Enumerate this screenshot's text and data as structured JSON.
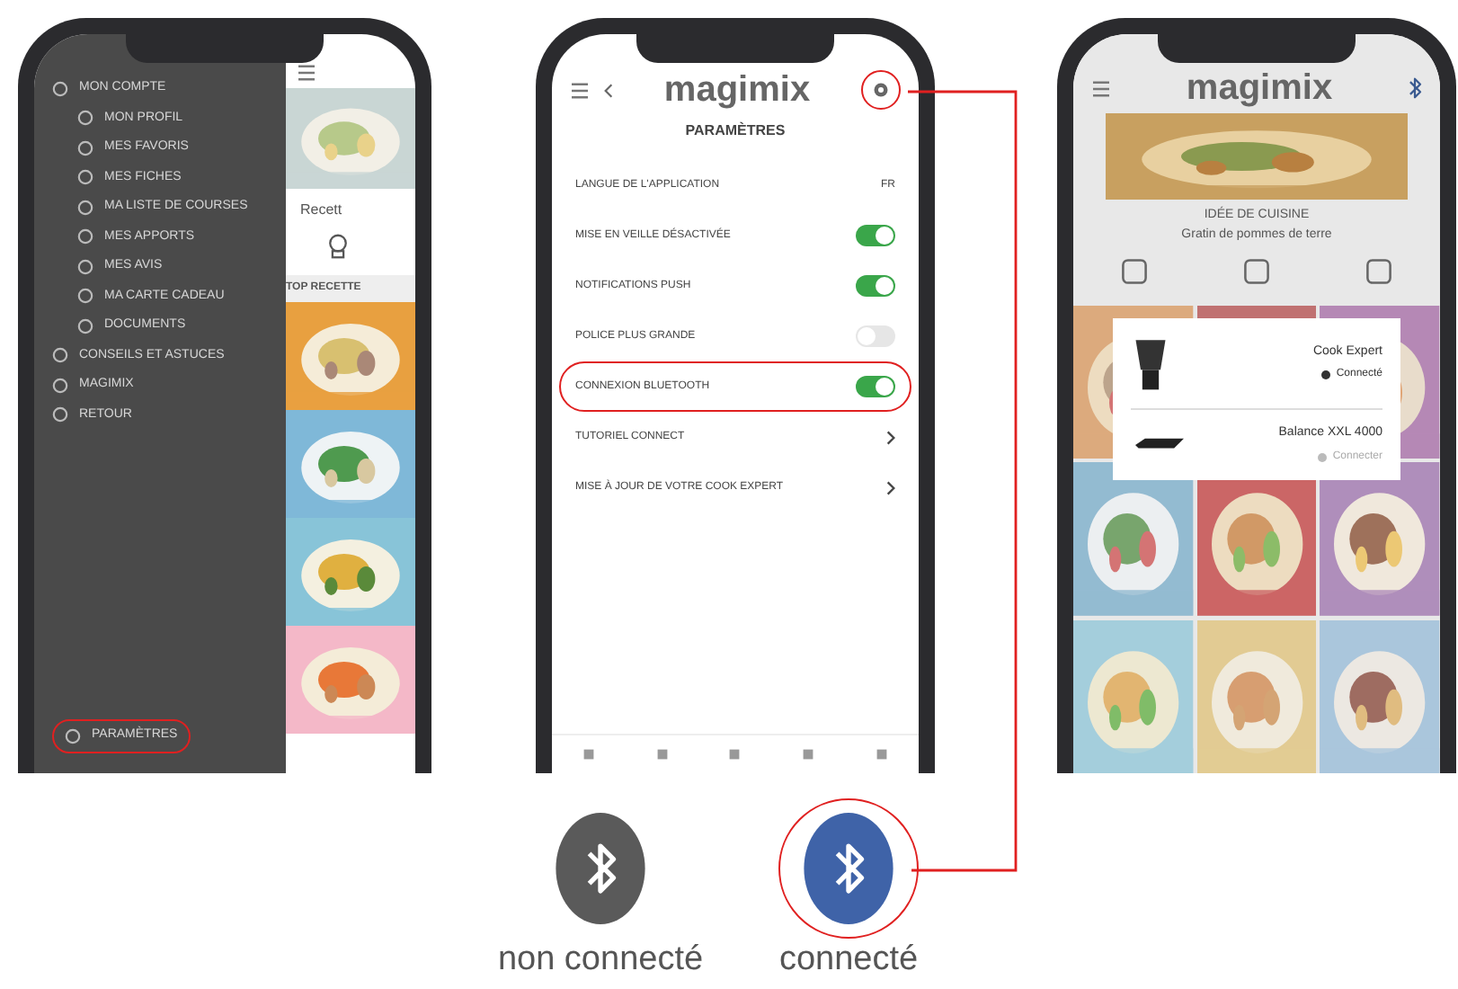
{
  "phone_menu": {
    "items": [
      {
        "label": "MON COMPTE",
        "children": [
          {
            "label": "MON PROFIL"
          },
          {
            "label": "MES FAVORIS"
          },
          {
            "label": "MES FICHES"
          },
          {
            "label": "MA LISTE DE COURSES"
          },
          {
            "label": "MES APPORTS"
          },
          {
            "label": "MES AVIS"
          },
          {
            "label": "MA CARTE CADEAU"
          },
          {
            "label": "DOCUMENTS"
          }
        ]
      },
      {
        "label": "CONSEILS ET ASTUCES"
      },
      {
        "label": "MAGIMIX"
      },
      {
        "label": "RETOUR"
      }
    ],
    "bottom_item": {
      "label": "PARAMÈTRES",
      "highlighted": true
    },
    "strip": {
      "card_title": "Recett",
      "section_title": "TOP RECETTE"
    }
  },
  "phone_settings": {
    "logo": "magimix",
    "title": "PARAMÈTRES",
    "gear_highlighted": true,
    "rows": [
      {
        "label": "LANGUE DE L'APPLICATION",
        "kind": "value",
        "value": "FR",
        "highlighted": false
      },
      {
        "label": "MISE EN VEILLE DÉSACTIVÉE",
        "kind": "toggle",
        "on": true,
        "highlighted": false
      },
      {
        "label": "NOTIFICATIONS PUSH",
        "kind": "toggle",
        "on": true,
        "highlighted": false
      },
      {
        "label": "POLICE PLUS GRANDE",
        "kind": "toggle",
        "on": false,
        "highlighted": false
      },
      {
        "label": "CONNEXION BLUETOOTH",
        "kind": "toggle",
        "on": true,
        "highlighted": true
      },
      {
        "label": "TUTORIEL CONNECT",
        "kind": "link",
        "highlighted": false
      },
      {
        "label": "MISE À JOUR DE VOTRE COOK EXPERT",
        "kind": "link",
        "highlighted": false
      }
    ]
  },
  "phone_home": {
    "logo": "magimix",
    "headline": "IDÉE DE CUISINE",
    "subline": "Gratin de pommes de terre",
    "devices": [
      {
        "name": "Cook Expert",
        "status": "Connecté",
        "kind": "robot",
        "connected": true
      },
      {
        "name": "Balance XXL 4000",
        "status": "Connecter",
        "kind": "scale",
        "connected": false
      }
    ]
  },
  "legend": [
    {
      "label": "non connecté",
      "connected": false
    },
    {
      "label": "connecté",
      "connected": true,
      "highlighted": true
    }
  ]
}
